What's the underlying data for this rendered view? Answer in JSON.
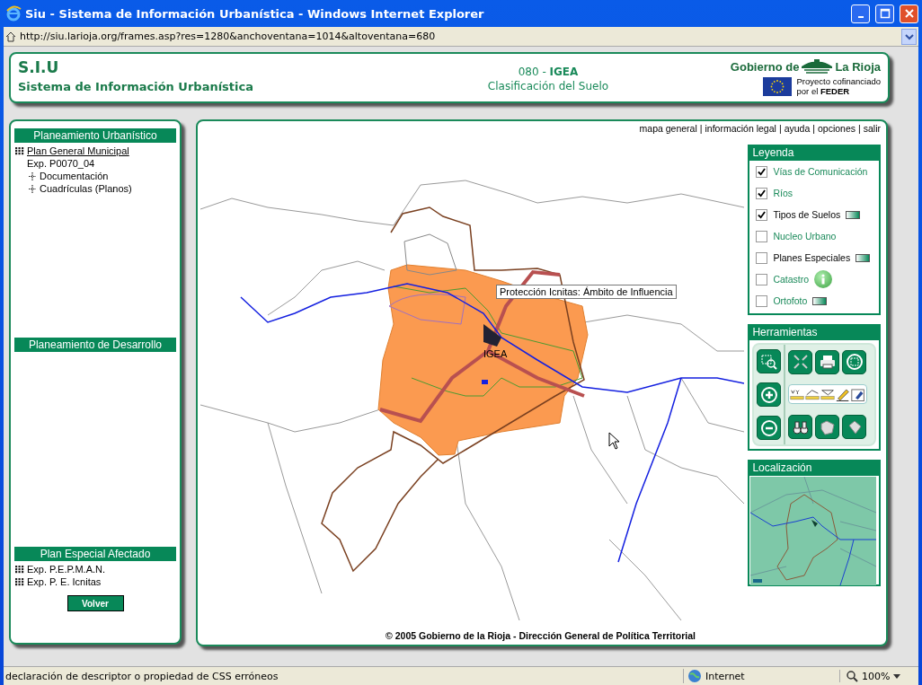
{
  "window": {
    "title": "Siu - Sistema de Información Urbanística - Windows Internet Explorer",
    "url": "http://siu.larioja.org/frames.asp?res=1280&anchoventana=1014&altoventana=680"
  },
  "header": {
    "acronym": "S.I.U",
    "system": "Sistema de Información Urbanística",
    "municipality": "080 - **IGEA**",
    "subtitle": "Clasificación del Suelo",
    "logo_left": "Gobierno de",
    "logo_right": "La Rioja",
    "funding_line1": "Proyecto cofinanciado",
    "funding_line2": "por el **FEDER**"
  },
  "sidebar": {
    "sections": [
      {
        "title": "Planeamiento Urbanístico",
        "items": [
          {
            "kind": "grid",
            "label": "Plan General Municipal",
            "children": [
              {
                "kind": "plain",
                "label": "Exp. P0070_04"
              },
              {
                "kind": "expand",
                "label": "Documentación"
              },
              {
                "kind": "expand",
                "label": "Cuadrículas (Planos)"
              }
            ]
          }
        ]
      },
      {
        "title": "Planeamiento de Desarrollo"
      },
      {
        "title": "Plan Especial Afectado",
        "items": [
          {
            "kind": "grid",
            "label": "Exp. P.E.P.M.A.N."
          },
          {
            "kind": "grid",
            "label": "Exp. P. E. Icnitas"
          }
        ]
      }
    ],
    "button": "Volver"
  },
  "top_links": [
    "mapa general",
    "información legal",
    "ayuda",
    "opciones",
    "salir"
  ],
  "top_links_separator": "|",
  "map": {
    "tooltip": "Protección Icnitas: Ámbito de Influencia",
    "place_label": "IGEA"
  },
  "legend": {
    "title": "Leyenda",
    "items": [
      {
        "label": "Vías de Comunicación",
        "checked": true,
        "kind": "link"
      },
      {
        "label": "Ríos",
        "checked": true,
        "kind": "link"
      },
      {
        "label": "Tipos de Suelos",
        "checked": true,
        "kind": "text-swatch"
      },
      {
        "label": "Nucleo Urbano",
        "checked": false,
        "kind": "link"
      },
      {
        "label": "Planes Especiales",
        "checked": false,
        "kind": "text-swatch"
      },
      {
        "label": "Catastro",
        "checked": false,
        "kind": "link-info"
      },
      {
        "label": "Ortofoto",
        "checked": false,
        "kind": "link-swatch"
      }
    ]
  },
  "tools": {
    "title": "Herramientas"
  },
  "locator": {
    "title": "Localización"
  },
  "footer": "© 2005 Gobierno de la Rioja - Dirección General de Política Territorial",
  "status_bar": {
    "message": "declaración de descriptor o propiedad de CSS erróneos",
    "zone": "Internet",
    "zoom": "100%"
  }
}
